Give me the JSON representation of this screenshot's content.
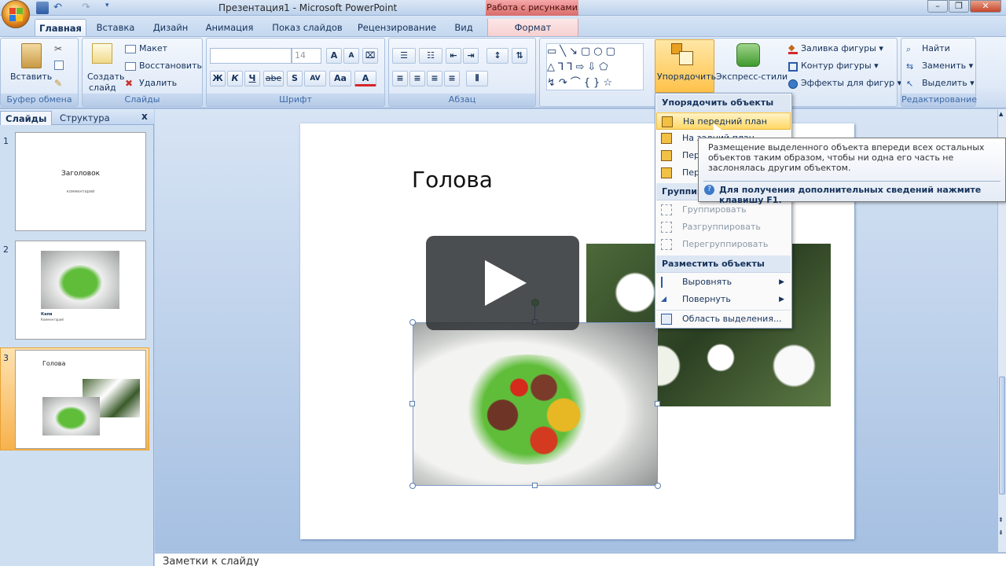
{
  "window": {
    "title": "Презентация1 - Microsoft PowerPoint",
    "context_tools": "Работа с рисунками",
    "minimize": "–",
    "restore": "❐",
    "close": "✕"
  },
  "tabs": [
    "Главная",
    "Вставка",
    "Дизайн",
    "Анимация",
    "Показ слайдов",
    "Рецензирование",
    "Вид",
    "Формат"
  ],
  "ribbon": {
    "clipboard": {
      "paste": "Вставить",
      "label": "Буфер обмена"
    },
    "slides": {
      "create": "Создать",
      "create2": "слайд",
      "layout": "Макет",
      "reset": "Восстановить",
      "delete": "Удалить",
      "label": "Слайды"
    },
    "font": {
      "size": "14",
      "label": "Шрифт",
      "bold": "Ж",
      "italic": "К",
      "underline": "Ч",
      "strike": "abe",
      "shadow": "S",
      "spacing": "AV",
      "case": "Aa",
      "color": "A"
    },
    "paragraph": {
      "label": "Абзац"
    },
    "drawing": {
      "arrange": "Упорядочить",
      "quick_styles": "Экспресс-стили",
      "fill": "Заливка фигуры",
      "outline": "Контур фигуры",
      "effects": "Эффекты для фигур"
    },
    "editing": {
      "find": "Найти",
      "replace": "Заменить",
      "select": "Выделить",
      "label": "Редактирование"
    }
  },
  "pane": {
    "tab_slides": "Слайды",
    "tab_outline": "Структура",
    "close": "x",
    "thumbs": [
      {
        "num": "1",
        "title": "Заголовок",
        "subtitle": "комментарий"
      },
      {
        "num": "2",
        "title": "Капи",
        "subtitle": "Комментарий"
      },
      {
        "num": "3",
        "title": "Голова"
      }
    ]
  },
  "slide": {
    "title": "Голова"
  },
  "notes": "Заметки к слайду",
  "menu": {
    "header1": "Упорядочить объекты",
    "bring_front": "На передний план",
    "send_back": "На задний план",
    "forward": "Переместить вперед",
    "backward": "Переместить назад",
    "header2": "Группировать объекты",
    "group": "Группировать",
    "ungroup": "Разгруппировать",
    "regroup": "Перегруппировать",
    "header3": "Разместить объекты",
    "align": "Выровнять",
    "rotate": "Повернуть",
    "selection_pane": "Область выделения..."
  },
  "tooltip": {
    "body": "Размещение выделенного объекта впереди всех остальных объектов таким образом, чтобы ни одна его часть не заслонялась другим объектом.",
    "help": "Для получения дополнительных сведений нажмите клавишу F1."
  }
}
